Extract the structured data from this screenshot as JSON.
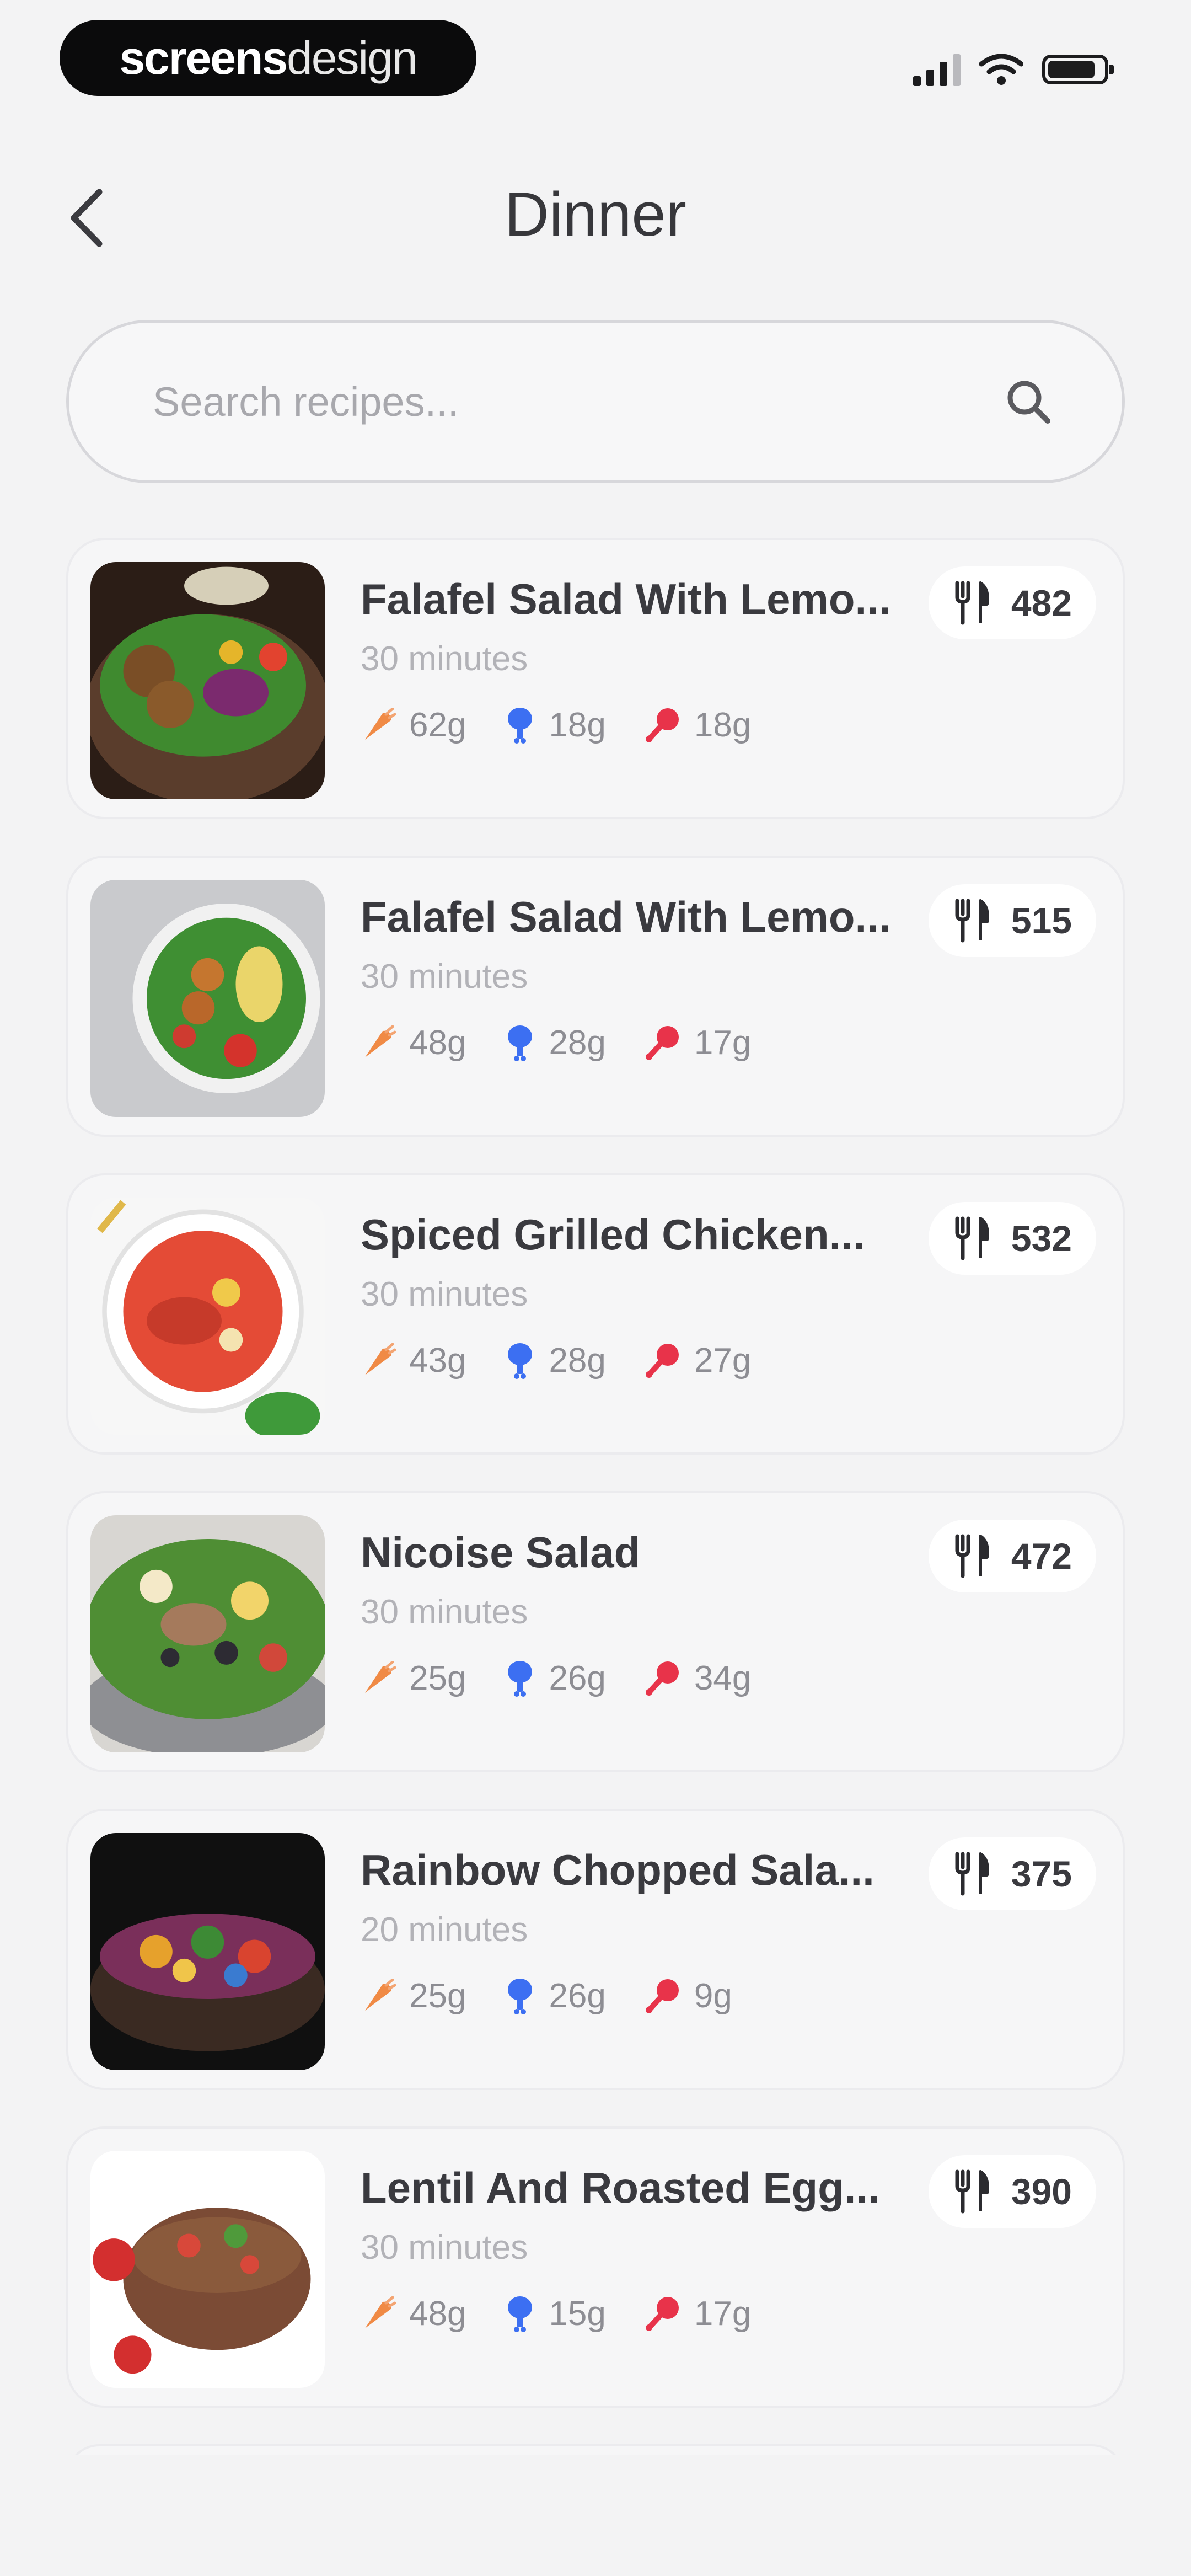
{
  "status_bar": {
    "brand_bold": "screens",
    "brand_light": "design"
  },
  "header": {
    "title": "Dinner"
  },
  "search": {
    "placeholder": "Search recipes..."
  },
  "colors": {
    "carbs": "#f08a45",
    "protein": "#3c6ff2",
    "fat": "#e8334a"
  },
  "recipes": [
    {
      "title": "Falafel Salad With Lemo...",
      "time": "30 minutes",
      "carbs": "62g",
      "protein": "18g",
      "fat": "18g",
      "calories": "482"
    },
    {
      "title": "Falafel Salad With Lemo...",
      "time": "30 minutes",
      "carbs": "48g",
      "protein": "28g",
      "fat": "17g",
      "calories": "515"
    },
    {
      "title": "Spiced Grilled Chicken...",
      "time": "30 minutes",
      "carbs": "43g",
      "protein": "28g",
      "fat": "27g",
      "calories": "532"
    },
    {
      "title": "Nicoise Salad",
      "time": "30 minutes",
      "carbs": "25g",
      "protein": "26g",
      "fat": "34g",
      "calories": "472"
    },
    {
      "title": "Rainbow Chopped Sala...",
      "time": "20 minutes",
      "carbs": "25g",
      "protein": "26g",
      "fat": "9g",
      "calories": "375"
    },
    {
      "title": "Lentil And Roasted Egg...",
      "time": "30 minutes",
      "carbs": "48g",
      "protein": "15g",
      "fat": "17g",
      "calories": "390"
    }
  ]
}
